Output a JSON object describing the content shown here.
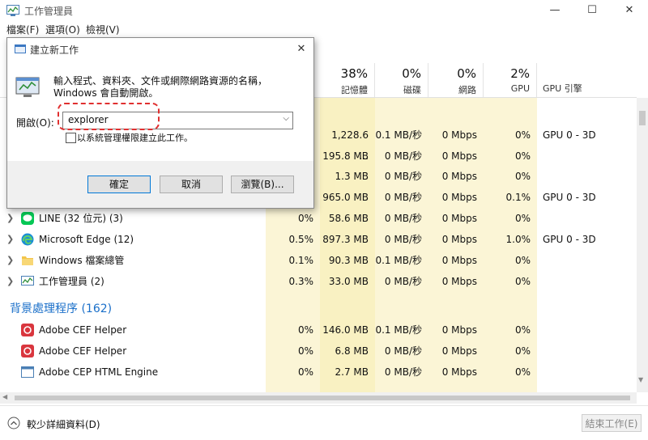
{
  "window": {
    "title": "工作管理員",
    "minimize": "—",
    "maximize": "☐",
    "close": "✕"
  },
  "menu": [
    "檔案(F)",
    "選項(O)",
    "檢視(V)"
  ],
  "columns": [
    {
      "pct": "38%",
      "label": "記憶體"
    },
    {
      "pct": "0%",
      "label": "磁碟"
    },
    {
      "pct": "0%",
      "label": "網路"
    },
    {
      "pct": "2%",
      "label": "GPU"
    }
  ],
  "gpu_engine_header": "GPU 引擎",
  "hidden_rows": [
    {
      "cpu": "",
      "mem": "1,228.6 ...",
      "disk": "0.1 MB/秒",
      "net": "0 Mbps",
      "gpu": "0%",
      "engine": "GPU 0 - 3D"
    },
    {
      "cpu": "",
      "mem": "195.8 MB",
      "disk": "0 MB/秒",
      "net": "0 Mbps",
      "gpu": "0%",
      "engine": ""
    },
    {
      "cpu": "",
      "mem": "1.3 MB",
      "disk": "0 MB/秒",
      "net": "0 Mbps",
      "gpu": "0%",
      "engine": ""
    },
    {
      "cpu": "",
      "mem": "965.0 MB",
      "disk": "0 MB/秒",
      "net": "0 Mbps",
      "gpu": "0.1%",
      "engine": "GPU 0 - 3D"
    }
  ],
  "apps": [
    {
      "name": "LINE (32 位元) (3)",
      "icon": "line-icon",
      "cpu": "0%",
      "mem": "58.6 MB",
      "disk": "0 MB/秒",
      "net": "0 Mbps",
      "gpu": "0%",
      "engine": ""
    },
    {
      "name": "Microsoft Edge (12)",
      "icon": "edge-icon",
      "cpu": "0.5%",
      "mem": "897.3 MB",
      "disk": "0 MB/秒",
      "net": "0 Mbps",
      "gpu": "1.0%",
      "engine": "GPU 0 - 3D"
    },
    {
      "name": "Windows 檔案總管",
      "icon": "folder-icon",
      "cpu": "0.1%",
      "mem": "90.3 MB",
      "disk": "0.1 MB/秒",
      "net": "0 Mbps",
      "gpu": "0%",
      "engine": ""
    },
    {
      "name": "工作管理員 (2)",
      "icon": "task-manager-icon",
      "cpu": "0.3%",
      "mem": "33.0 MB",
      "disk": "0 MB/秒",
      "net": "0 Mbps",
      "gpu": "0%",
      "engine": ""
    }
  ],
  "background_section": "背景處理程序 (162)",
  "background": [
    {
      "name": "Adobe CEF Helper",
      "icon": "adobe-icon",
      "cpu": "0%",
      "mem": "146.0 MB",
      "disk": "0.1 MB/秒",
      "net": "0 Mbps",
      "gpu": "0%"
    },
    {
      "name": "Adobe CEF Helper",
      "icon": "adobe-icon",
      "cpu": "0%",
      "mem": "6.8 MB",
      "disk": "0 MB/秒",
      "net": "0 Mbps",
      "gpu": "0%"
    },
    {
      "name": "Adobe CEP HTML Engine",
      "icon": "window-icon",
      "cpu": "0%",
      "mem": "2.7 MB",
      "disk": "0 MB/秒",
      "net": "0 Mbps",
      "gpu": "0%"
    }
  ],
  "footer": {
    "fewer_details": "較少詳細資料(D)",
    "end_task": "結束工作(E)"
  },
  "dialog": {
    "title": "建立新工作",
    "close": "✕",
    "description": "輸入程式、資料夾、文件或網際網路資源的名稱，Windows 會自動開啟。",
    "open_label": "開啟(O):",
    "open_value": "explorer",
    "admin_checkbox": "以系統管理權限建立此工作。",
    "ok": "確定",
    "cancel": "取消",
    "browse": "瀏覽(B)..."
  },
  "colors": {
    "usage_bg": "#fbf5d6",
    "usage_bg_strong": "#f9f1c2",
    "section_blue": "#1a6fc9",
    "highlight": "#e03030"
  }
}
